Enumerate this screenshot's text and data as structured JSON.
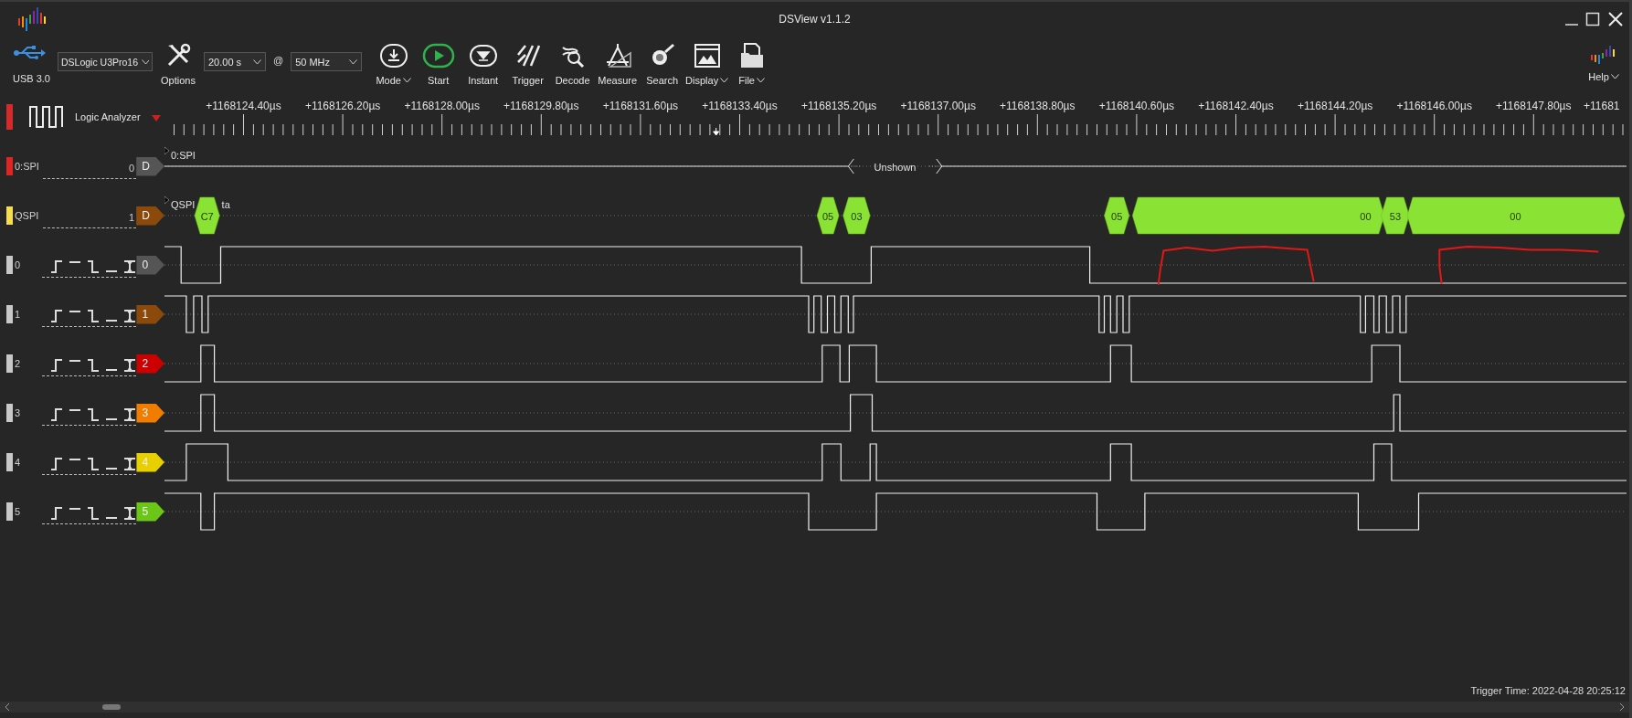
{
  "window": {
    "title": "DSView v1.1.2"
  },
  "toolbar": {
    "connection": "USB 3.0",
    "device": "DSLogic U3Pro16",
    "options": "Options",
    "duration": "20.00 s",
    "at": "@",
    "sample_rate": "50 MHz",
    "buttons": [
      {
        "kind": "mode",
        "label": "Mode",
        "menu": true
      },
      {
        "kind": "start",
        "label": "Start",
        "menu": false
      },
      {
        "kind": "instant",
        "label": "Instant",
        "menu": false
      },
      {
        "kind": "trigger",
        "label": "Trigger",
        "menu": false
      },
      {
        "kind": "decode",
        "label": "Decode",
        "menu": false
      },
      {
        "kind": "measure",
        "label": "Measure",
        "menu": false
      },
      {
        "kind": "search",
        "label": "Search",
        "menu": false
      },
      {
        "kind": "display",
        "label": "Display",
        "menu": true
      },
      {
        "kind": "file",
        "label": "File",
        "menu": true
      }
    ],
    "help": {
      "label": "Help",
      "menu": true
    }
  },
  "mode_panel": {
    "label": "Logic Analyzer",
    "swatch": {
      "color": "#d42a2a"
    }
  },
  "ruler": {
    "labels": [
      "+1168124.40µs",
      "+1168126.20µs",
      "+1168128.00µs",
      "+1168129.80µs",
      "+1168131.60µs",
      "+1168133.40µs",
      "+1168135.20µs",
      "+1168137.00µs",
      "+1168138.80µs",
      "+1168140.60µs",
      "+1168142.40µs",
      "+1168144.20µs",
      "+1168146.00µs",
      "+1168147.80µs",
      "+11681"
    ]
  },
  "channels": [
    {
      "kind": "decoder",
      "name": "0:SPI",
      "number": "0",
      "swatch": {
        "color": "#e02424"
      },
      "tag": {
        "text": "D",
        "color": "#555555"
      },
      "trace_label": "0:SPI",
      "annotations": [
        {
          "text": "Unshown"
        }
      ]
    },
    {
      "kind": "decoder",
      "name": "QSPI",
      "number": "1",
      "swatch": {
        "color": "#f5dc50"
      },
      "tag": {
        "text": "D",
        "color": "#8b4a0c"
      },
      "trace_label": "QSPI",
      "trace_label_tail": "ta",
      "segments": [
        {
          "text": "C7"
        },
        {
          "text": "05"
        },
        {
          "text": "03"
        },
        {
          "text": "05"
        },
        {
          "text": "00"
        },
        {
          "text": "53"
        },
        {
          "text": "00"
        }
      ]
    },
    {
      "kind": "logic",
      "name": "0",
      "swatch": {
        "color": "#c8c8c8"
      },
      "tag": {
        "text": "0",
        "color": "#555555"
      }
    },
    {
      "kind": "logic",
      "name": "1",
      "swatch": {
        "color": "#c8c8c8"
      },
      "tag": {
        "text": "1",
        "color": "#8b4a0c"
      }
    },
    {
      "kind": "logic",
      "name": "2",
      "swatch": {
        "color": "#c8c8c8"
      },
      "tag": {
        "text": "2",
        "color": "#cc0000"
      }
    },
    {
      "kind": "logic",
      "name": "3",
      "swatch": {
        "color": "#c8c8c8"
      },
      "tag": {
        "text": "3",
        "color": "#f07d00"
      }
    },
    {
      "kind": "logic",
      "name": "4",
      "swatch": {
        "color": "#c8c8c8"
      },
      "tag": {
        "text": "4",
        "color": "#e8d000"
      }
    },
    {
      "kind": "logic",
      "name": "5",
      "swatch": {
        "color": "#c8c8c8"
      },
      "tag": {
        "text": "5",
        "color": "#6cc618"
      }
    }
  ],
  "status": {
    "trigger_time": "Trigger Time: 2022-04-28 20:25:12"
  }
}
